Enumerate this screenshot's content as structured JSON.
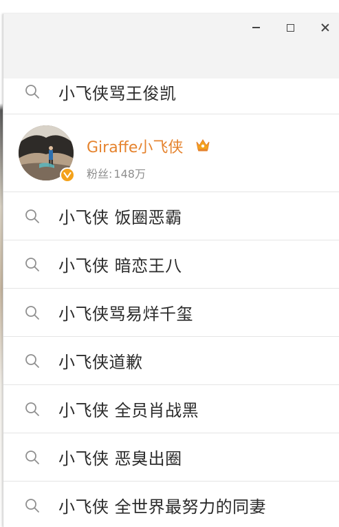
{
  "window": {
    "minimize_label": "–",
    "maximize_label": "☐",
    "close_label": "✕"
  },
  "top_suggestion": "小飞侠骂王俊凯",
  "user_card": {
    "name": "Giraffe小飞侠",
    "followers_label": "粉丝:",
    "followers_count": "148万",
    "badge_color": "#f4a21b",
    "name_color": "#e5832e"
  },
  "suggestions": [
    "小飞侠 饭圈恶霸",
    "小飞侠 暗恋王八",
    "小飞侠骂易烊千玺",
    "小飞侠道歉",
    "小飞侠 全员肖战黑",
    "小飞侠 恶臭出圈",
    "小飞侠 全世界最努力的同妻"
  ]
}
